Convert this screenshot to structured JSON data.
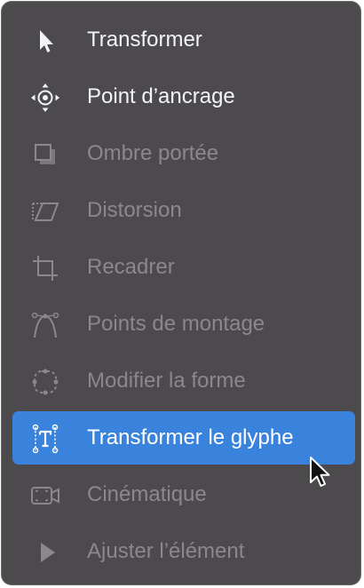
{
  "menu": {
    "items": [
      {
        "label": "Transformer",
        "icon": "arrow-pointer-icon",
        "state": "enabled"
      },
      {
        "label": "Point d’ancrage",
        "icon": "anchor-point-icon",
        "state": "enabled"
      },
      {
        "label": "Ombre portée",
        "icon": "drop-shadow-icon",
        "state": "disabled"
      },
      {
        "label": "Distorsion",
        "icon": "distort-icon",
        "state": "disabled"
      },
      {
        "label": "Recadrer",
        "icon": "crop-icon",
        "state": "disabled"
      },
      {
        "label": "Points de montage",
        "icon": "edit-points-icon",
        "state": "disabled"
      },
      {
        "label": "Modifier la forme",
        "icon": "modify-shape-icon",
        "state": "disabled"
      },
      {
        "label": "Transformer le glyphe",
        "icon": "transform-glyph-icon",
        "state": "selected"
      },
      {
        "label": "Cinématique",
        "icon": "cinematic-icon",
        "state": "disabled"
      },
      {
        "label": "Ajuster l’élément",
        "icon": "adjust-item-icon",
        "state": "disabled"
      }
    ]
  },
  "colors": {
    "menu_background": "#4d4a4e",
    "selection": "#3a83dc",
    "text_enabled": "#f4f3f5",
    "text_disabled": "#8b888c"
  }
}
